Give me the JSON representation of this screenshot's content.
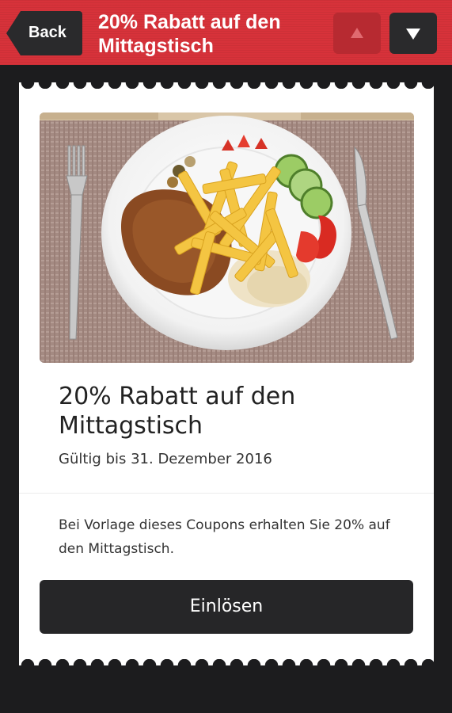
{
  "header": {
    "back_label": "Back",
    "title": "20% Rabatt auf den Mittagstisch",
    "prev_icon": "triangle-up-icon",
    "next_icon": "triangle-down-icon",
    "bar_color": "#d7323a"
  },
  "coupon": {
    "image_alt": "plate-with-schnitzel-and-fries",
    "title": "20% Rabatt auf den Mittagstisch",
    "valid_until": "Gültig bis 31. Dezember 2016",
    "description": "Bei Vorlage dieses Coupons erhalten Sie 20% auf den Mittagstisch.",
    "redeem_label": "Einlösen"
  }
}
